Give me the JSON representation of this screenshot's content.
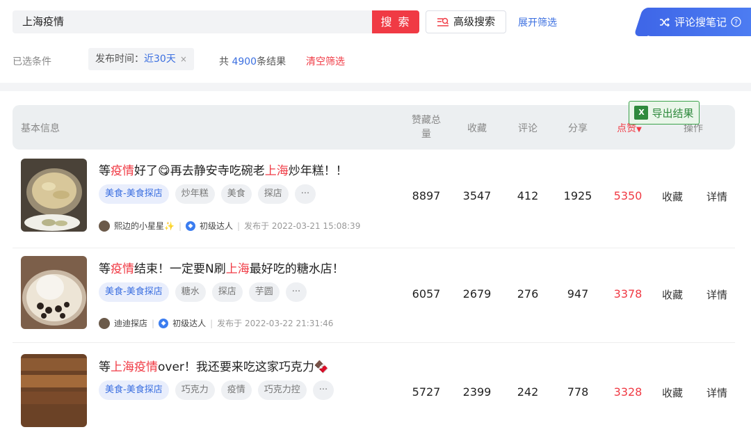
{
  "search": {
    "value": "上海疫情",
    "button": "搜 索",
    "advanced": "高级搜索",
    "expand": "展开筛选",
    "notes_button": "评论搜笔记"
  },
  "conditions": {
    "label": "已选条件",
    "chip_key": "发布时间：",
    "chip_value": "近30天",
    "chip_close": "×",
    "total_prefix": "共",
    "total_count": "4900",
    "total_suffix": "条结果",
    "clear": "清空筛选"
  },
  "table": {
    "headers": {
      "basic": "基本信息",
      "total_a": "赞藏总",
      "total_b": "量",
      "fav": "收藏",
      "comment": "评论",
      "share": "分享",
      "like": "点赞",
      "like_sort": "▼",
      "ops": "操作"
    },
    "export": "导出结果",
    "rows": [
      {
        "title_parts": [
          "等",
          "疫情",
          "好了😋再去静安寺吃碗老",
          "上海",
          "炒年糕！！"
        ],
        "tags": [
          "美食-美食探店",
          "炒年糕",
          "美食",
          "探店",
          "···"
        ],
        "author": "熙边的小星星✨",
        "level": "初级达人",
        "published": "发布于  2022-03-21 15:08:39",
        "total": "8897",
        "fav": "3547",
        "comment": "412",
        "share": "1925",
        "like": "5350",
        "act_fav": "收藏",
        "act_detail": "详情"
      },
      {
        "title_parts": [
          "等",
          "疫情",
          "结束！一定要N刷",
          "上海",
          "最好吃的糖水店！"
        ],
        "tags": [
          "美食-美食探店",
          "糖水",
          "探店",
          "芋圆",
          "···"
        ],
        "author": "迪迪探店",
        "level": "初级达人",
        "published": "发布于  2022-03-22 21:31:46",
        "total": "6057",
        "fav": "2679",
        "comment": "276",
        "share": "947",
        "like": "3378",
        "act_fav": "收藏",
        "act_detail": "详情"
      },
      {
        "title_parts": [
          "等",
          "上海疫情",
          "over！我还要来吃这家巧克力🍫",
          "",
          ""
        ],
        "tags": [
          "美食-美食探店",
          "巧克力",
          "疫情",
          "巧克力控",
          "···"
        ],
        "author": "",
        "level": "",
        "published": "",
        "total": "5727",
        "fav": "2399",
        "comment": "242",
        "share": "778",
        "like": "3328",
        "act_fav": "收藏",
        "act_detail": "详情"
      }
    ]
  },
  "colors": {
    "accent": "#f03a44",
    "link": "#3b6fe0",
    "export": "#2f8a3d"
  }
}
